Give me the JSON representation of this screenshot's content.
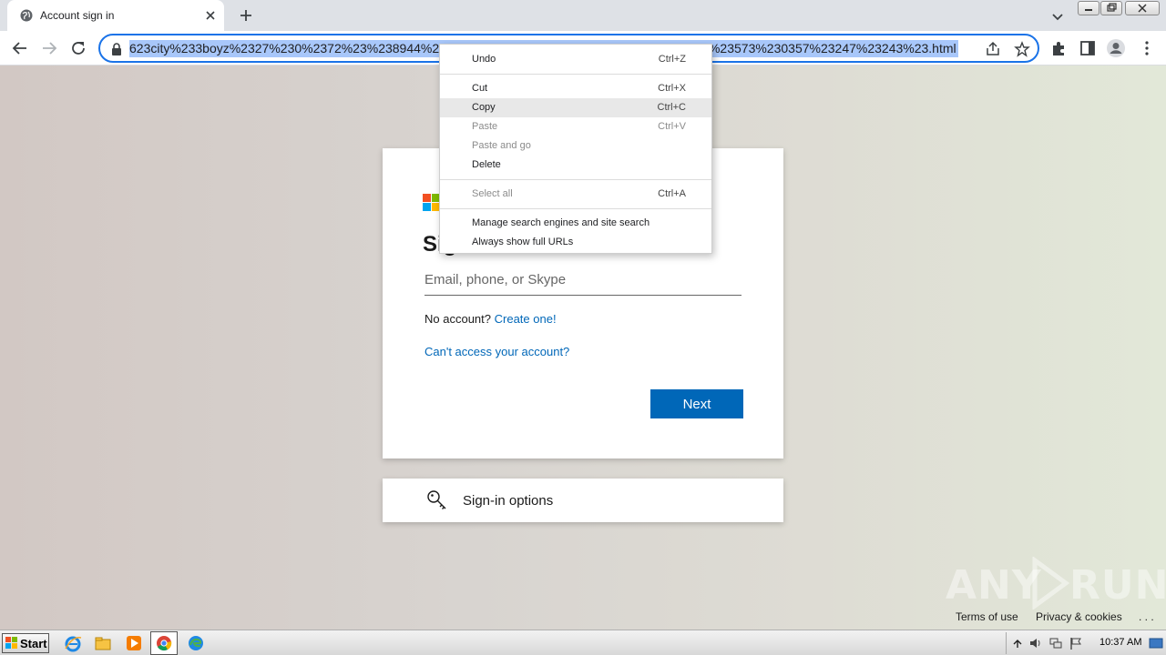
{
  "browser": {
    "tab_title": "Account sign in",
    "url": "623city%233boyz%2327%230%2372%23%238944%2327%233271%2330057%2385%23243%23573%23573%230357%23247%23243%23.html"
  },
  "context_menu": {
    "items": [
      {
        "label": "Undo",
        "shortcut": "Ctrl+Z"
      },
      {
        "label": "Cut",
        "shortcut": "Ctrl+X"
      },
      {
        "label": "Copy",
        "shortcut": "Ctrl+C"
      },
      {
        "label": "Paste",
        "shortcut": "Ctrl+V"
      },
      {
        "label": "Paste and go",
        "shortcut": ""
      },
      {
        "label": "Delete",
        "shortcut": ""
      },
      {
        "label": "Select all",
        "shortcut": "Ctrl+A"
      },
      {
        "label": "Manage search engines and site search",
        "shortcut": ""
      },
      {
        "label": "Always show full URLs",
        "shortcut": ""
      }
    ]
  },
  "signin": {
    "heading": "Sig",
    "email_placeholder": "Email, phone, or Skype",
    "no_account_text": "No account?",
    "create_link": "Create one!",
    "cant_access_link": "Can't access your account?",
    "next_label": "Next",
    "options_label": "Sign-in options"
  },
  "footer": {
    "terms": "Terms of use",
    "privacy": "Privacy & cookies",
    "more": ". . ."
  },
  "watermark": {
    "left": "ANY",
    "right": "RUN"
  },
  "taskbar": {
    "start_label": "Start",
    "clock": "10:37 AM"
  },
  "colors": {
    "accent": "#0067b8",
    "omnibox_focus": "#1a73e8",
    "url_selection": "#a8c7fa"
  }
}
